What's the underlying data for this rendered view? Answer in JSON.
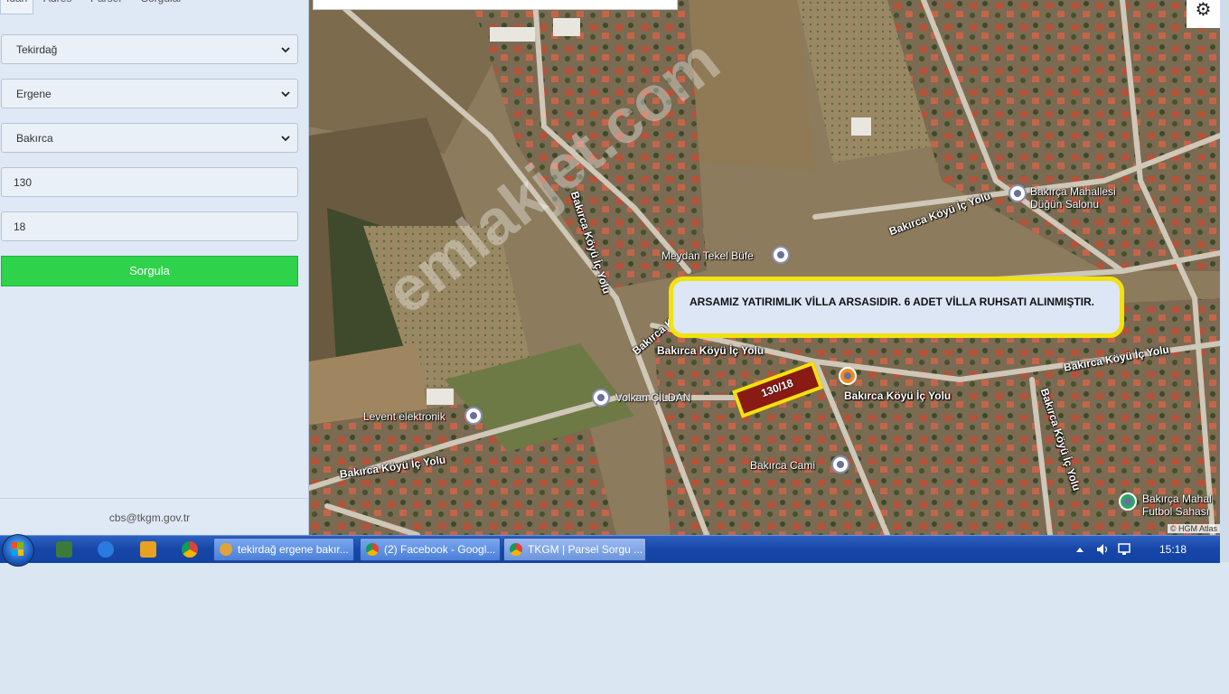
{
  "left_panel": {
    "tabs": [
      "İdari",
      "Adres",
      "Parsel",
      "Sorgular"
    ],
    "province": "Tekirdağ",
    "district": "Ergene",
    "neighborhood": "Bakırca",
    "block_no": "130",
    "parcel_no": "18",
    "query_button": "Sorgula",
    "footer_email": "cbs@tkgm.gov.tr"
  },
  "map": {
    "callout_text": "ARSAMIZ YATIRIMLIK VİLLA ARSASIDIR. 6 ADET VİLLA RUHSATI ALINMIŞTIR.",
    "parcel_label": "130/18",
    "watermark": "emlakjet.com",
    "attribution": "© HGM Atlas",
    "settings_icon": "⚙",
    "road_labels": [
      "Bakırca Köyü İç Yolu",
      "Bakırca Köyü İç Yolu",
      "Bakırca Köyü İç Yolu",
      "Bakırca Köyü İç Yolu",
      "Bakırca Köyü İç Yolu",
      "Bakırca Köyü İç Yolu",
      "Bakırca Köyü İç Yolu",
      "Bakırca Köyü İç Yolu"
    ],
    "pois": {
      "meydan": "Meydan Tekel Büfe",
      "volkan": "Volkan ÇİLDAN",
      "levent": "Levent elektronik",
      "cami": "Bakırca Cami",
      "dugun_line1": "Bakırça Mahallesi",
      "dugun_line2": "Düğün Salonu",
      "futbol_line1": "Bakırça Mahal",
      "futbol_line2": "Futbol Sahası"
    }
  },
  "taskbar": {
    "windows": [
      "tekirdağ ergene bakır...",
      "(2) Facebook - Googl...",
      "TKGM | Parsel Sorgu ..."
    ],
    "clock": "15:18"
  }
}
